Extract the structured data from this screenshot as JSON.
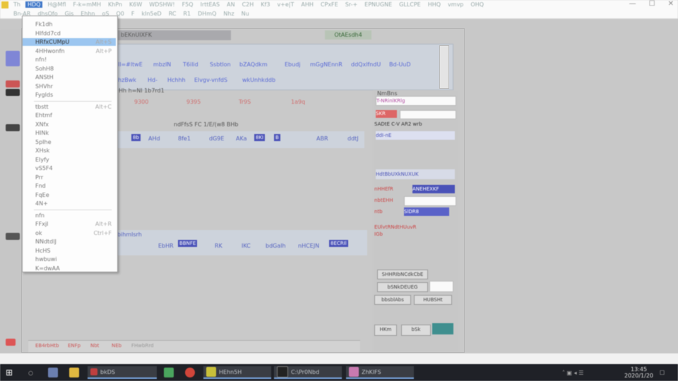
{
  "menubar": {
    "row1": [
      "Th",
      "HDQ",
      "H@Mfl",
      "F-k=mMH",
      "KhPn",
      "K6W",
      "WDSHW!",
      "F5Q",
      "IrttEAS",
      "AN",
      "C2H",
      "Kf3",
      "v+e|T",
      "AHH",
      "CPxFE",
      "Sr-+",
      "EPNUGNE",
      "GLLCPE",
      "HHQ",
      "vmvp",
      "OHQ"
    ],
    "row2": [
      "Bn-AR",
      "dhsOfo",
      "Gjs",
      "Ehhn",
      "oS",
      "Q0",
      "F",
      "kIn5eD",
      "RC",
      "R1",
      "DHmQ",
      "Nhz",
      "Nu"
    ],
    "active_item": "HDQ",
    "window_controls": [
      "—",
      "☐",
      "✕"
    ]
  },
  "dropdown": {
    "items": [
      {
        "label": "Fk1dh",
        "shortcut": ""
      },
      {
        "label": "Hlfdd7cd",
        "shortcut": ""
      },
      {
        "label": "HRfxCUMpU",
        "shortcut": "Alt+S",
        "selected": true
      },
      {
        "label": "4HHwonfn",
        "shortcut": "Alt+P"
      },
      {
        "label": "nfn!",
        "shortcut": ""
      },
      {
        "label": "SohH8",
        "shortcut": ""
      },
      {
        "label": "ANStH",
        "shortcut": ""
      },
      {
        "label": "SHVhr",
        "shortcut": ""
      },
      {
        "label": "Fyglds",
        "shortcut": ""
      },
      {
        "label": "tbstt",
        "shortcut": "Alt+C"
      },
      {
        "label": "Ehtmf",
        "shortcut": ""
      },
      {
        "label": "XNfx",
        "shortcut": ""
      },
      {
        "label": "HINk",
        "shortcut": ""
      },
      {
        "label": "5pIhe",
        "shortcut": ""
      },
      {
        "label": "XHsk",
        "shortcut": ""
      },
      {
        "label": "EIyfy",
        "shortcut": ""
      },
      {
        "label": "vS5F4",
        "shortcut": ""
      },
      {
        "label": "Prr",
        "shortcut": ""
      },
      {
        "label": "Fnd",
        "shortcut": ""
      },
      {
        "label": "FqEe",
        "shortcut": ""
      },
      {
        "label": "4N+",
        "shortcut": ""
      },
      {
        "label": "nfn",
        "shortcut": ""
      },
      {
        "label": "FFxjl",
        "shortcut": "Alt+R"
      },
      {
        "label": "ok",
        "shortcut": "Ctrl+F"
      },
      {
        "label": "NNdtdlJ",
        "shortcut": ""
      },
      {
        "label": "HcHS",
        "shortcut": ""
      },
      {
        "label": "hwbuwi",
        "shortcut": ""
      },
      {
        "label": "K=dwAA",
        "shortcut": ""
      }
    ]
  },
  "center": {
    "header_tab": "bEKnUIXFK",
    "green_button": "OtAEsdh4",
    "links_row1": [
      "ll=#ltwE",
      "mbzlN",
      "T6ilid",
      "Ssbtlon",
      "bZAQdkm",
      "Ebudj",
      "mGgNEnnR",
      "ddQxlfndU",
      "Bd-UuD"
    ],
    "links_row2": [
      "hzBwk",
      "Hd-",
      "Hchhh",
      "Elvgv-vnfdS",
      "wkUnhkddb"
    ],
    "info_line": "Hh h=Nl  1b7rd1",
    "red_values": [
      "9300",
      "9395",
      "Tr9S",
      "1a9q"
    ],
    "table_title": "ndFfsS  FC 1/E/(w8  BHb",
    "table_headers": [
      "8b",
      "AHd",
      "8fe1",
      "dG9E",
      "AKa",
      "8KI",
      "B",
      "ABR",
      "ddtJ"
    ],
    "subtitle": "bihmlsrh",
    "lower_headers": [
      "EbHR",
      "BBNFE",
      "RK",
      "IKC",
      "bdGalh",
      "nHCEJN",
      "8ECRIl"
    ]
  },
  "form": {
    "title": "NmBns",
    "field1": "T-NRinlKRlg",
    "label_red": "SKR",
    "row3": "SADtE C-V AR2 wrb",
    "row4_blue": "ddI-nE",
    "section": "HdtBbUXkNUXUK",
    "red_label2": "nHHEfR",
    "field_blue": "ANEHEXKF",
    "red_label3": "nbtEHH",
    "red_label4": "ntb",
    "field_blue2": "SlDR8",
    "warn": "EUlvtRNdtHUuvR",
    "warn2": "IGb",
    "btn1": "SHHRIbNCdkCbE",
    "btn2": "bSNkDEUEG",
    "btn3": "bbsblAbs",
    "btn4": "HUBSHt",
    "btn5": "HKm",
    "btn6": "bSk"
  },
  "bottom": {
    "tabs": [
      "EB4rbHtb",
      "ENFp",
      "Nbt",
      "NEb",
      "FHwbRrd"
    ]
  },
  "taskbar": {
    "items": [
      "bkDS",
      "HEhn5H",
      "C:\\Pr0Nbd",
      "ZhKlFS"
    ],
    "time": "13:45",
    "date": "2020/1/20"
  }
}
